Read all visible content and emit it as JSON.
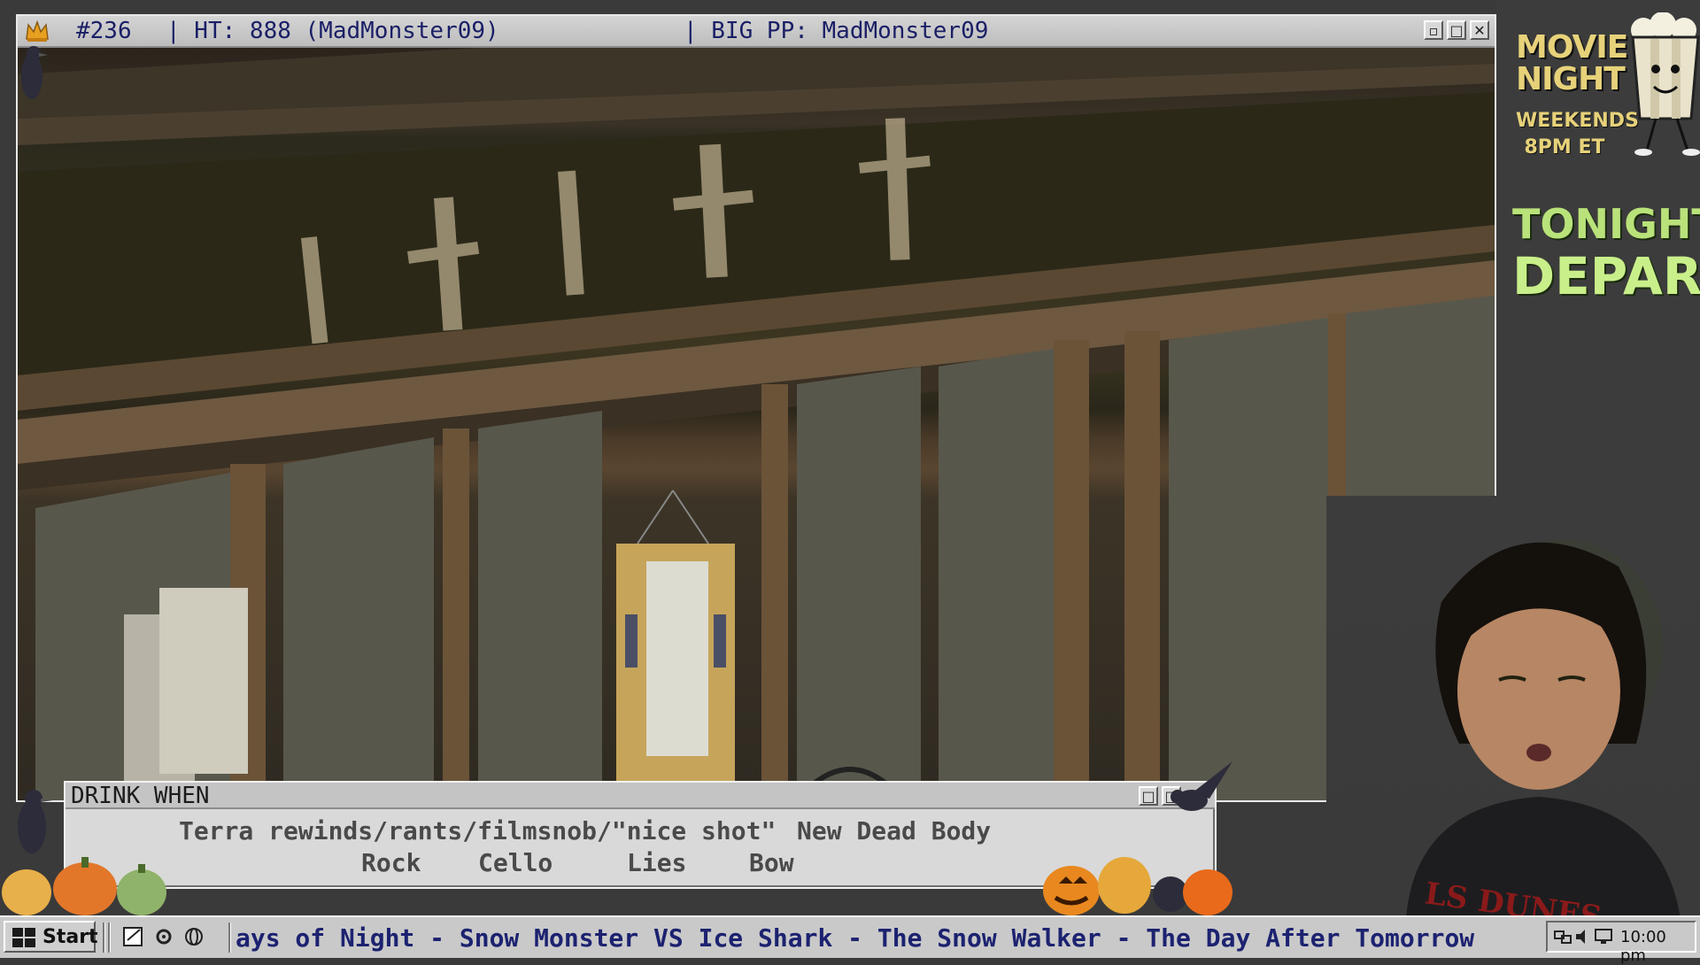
{
  "video_window": {
    "title_segments": [
      "#236",
      "| HT: 888 (MadMonster09)",
      "| BIG PP: MadMonster09"
    ],
    "buttons": [
      "minimize",
      "maximize",
      "close"
    ]
  },
  "side_panel": {
    "logo_line1": "MOVIE",
    "logo_line2": "NIGHT",
    "schedule_line1": "WEEKENDS",
    "schedule_line2": "8PM ET",
    "tonight_label": "TONIGHT:",
    "tonight_title": "DEPARTU"
  },
  "drink_window": {
    "title": "DRINK WHEN",
    "row1": [
      "Terra rewinds/rants/filmsnob/\"nice shot\"",
      "New Dead Body"
    ],
    "row2": [
      "Rock",
      "Cello",
      "Lies",
      "Bow"
    ]
  },
  "taskbar": {
    "start_label": "Start",
    "ticker_text": "ays of Night  -  Snow Monster VS Ice Shark  -  The Snow Walker  -  The Day After Tomorrow",
    "clock": "10:00 pm"
  },
  "colors": {
    "title_text": "#1a1f66",
    "accent_gold": "#e7d27a",
    "accent_green": "#b9e27a"
  }
}
